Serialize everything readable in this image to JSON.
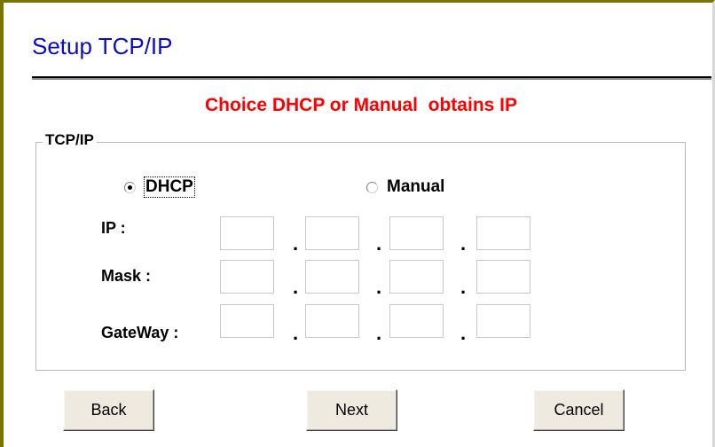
{
  "title": "Setup TCP/IP",
  "instruction": "Choice DHCP or Manual  obtains IP",
  "group_label": "TCP/IP",
  "mode": {
    "dhcp_label": "DHCP",
    "manual_label": "Manual",
    "selected": "DHCP"
  },
  "fields": {
    "ip_label": "IP :",
    "mask_label": "Mask :",
    "gateway_label": "GateWay :",
    "octet_separator": ".",
    "ip_octets": [
      "",
      "",
      "",
      ""
    ],
    "mask_octets": [
      "",
      "",
      "",
      ""
    ],
    "gateway_octets": [
      "",
      "",
      "",
      ""
    ]
  },
  "buttons": {
    "back": "Back",
    "next": "Next",
    "cancel": "Cancel"
  },
  "colors": {
    "title": "#0a0ad0",
    "instruction": "#ff0000",
    "frame": "#7a7400",
    "button_face": "#eeeae0"
  }
}
